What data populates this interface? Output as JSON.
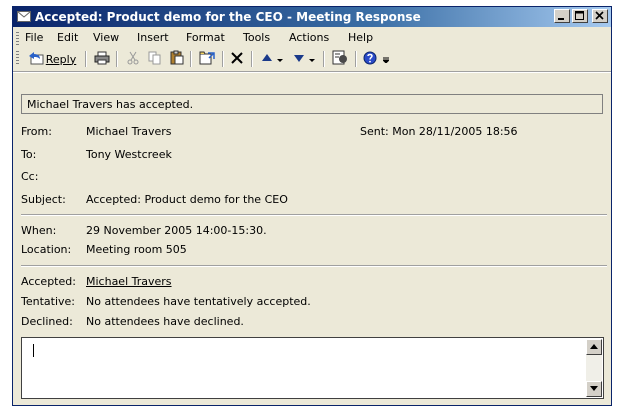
{
  "window": {
    "title": "Accepted: Product demo for the CEO - Meeting Response",
    "controls": [
      "minimize",
      "maximize",
      "close"
    ]
  },
  "menu": [
    "File",
    "Edit",
    "View",
    "Insert",
    "Format",
    "Tools",
    "Actions",
    "Help"
  ],
  "toolbar": {
    "reply_label": "Reply"
  },
  "banner": "Michael Travers has accepted.",
  "header": {
    "from_label": "From:",
    "from_value": "Michael Travers",
    "sent_value": "Sent: Mon 28/11/2005 18:56",
    "to_label": "To:",
    "to_value": "Tony Westcreek",
    "cc_label": "Cc:",
    "cc_value": "",
    "subject_label": "Subject:",
    "subject_value": "Accepted: Product demo for the CEO"
  },
  "meeting": {
    "when_label": "When:",
    "when_value": "29 November 2005 14:00-15:30.",
    "location_label": "Location:",
    "location_value": "Meeting room 505"
  },
  "attendees": {
    "accepted_label": "Accepted:",
    "accepted_value": "Michael Travers",
    "tentative_label": "Tentative:",
    "tentative_value": "No attendees have tentatively accepted.",
    "declined_label": "Declined:",
    "declined_value": "No attendees have declined."
  },
  "message_body": ""
}
